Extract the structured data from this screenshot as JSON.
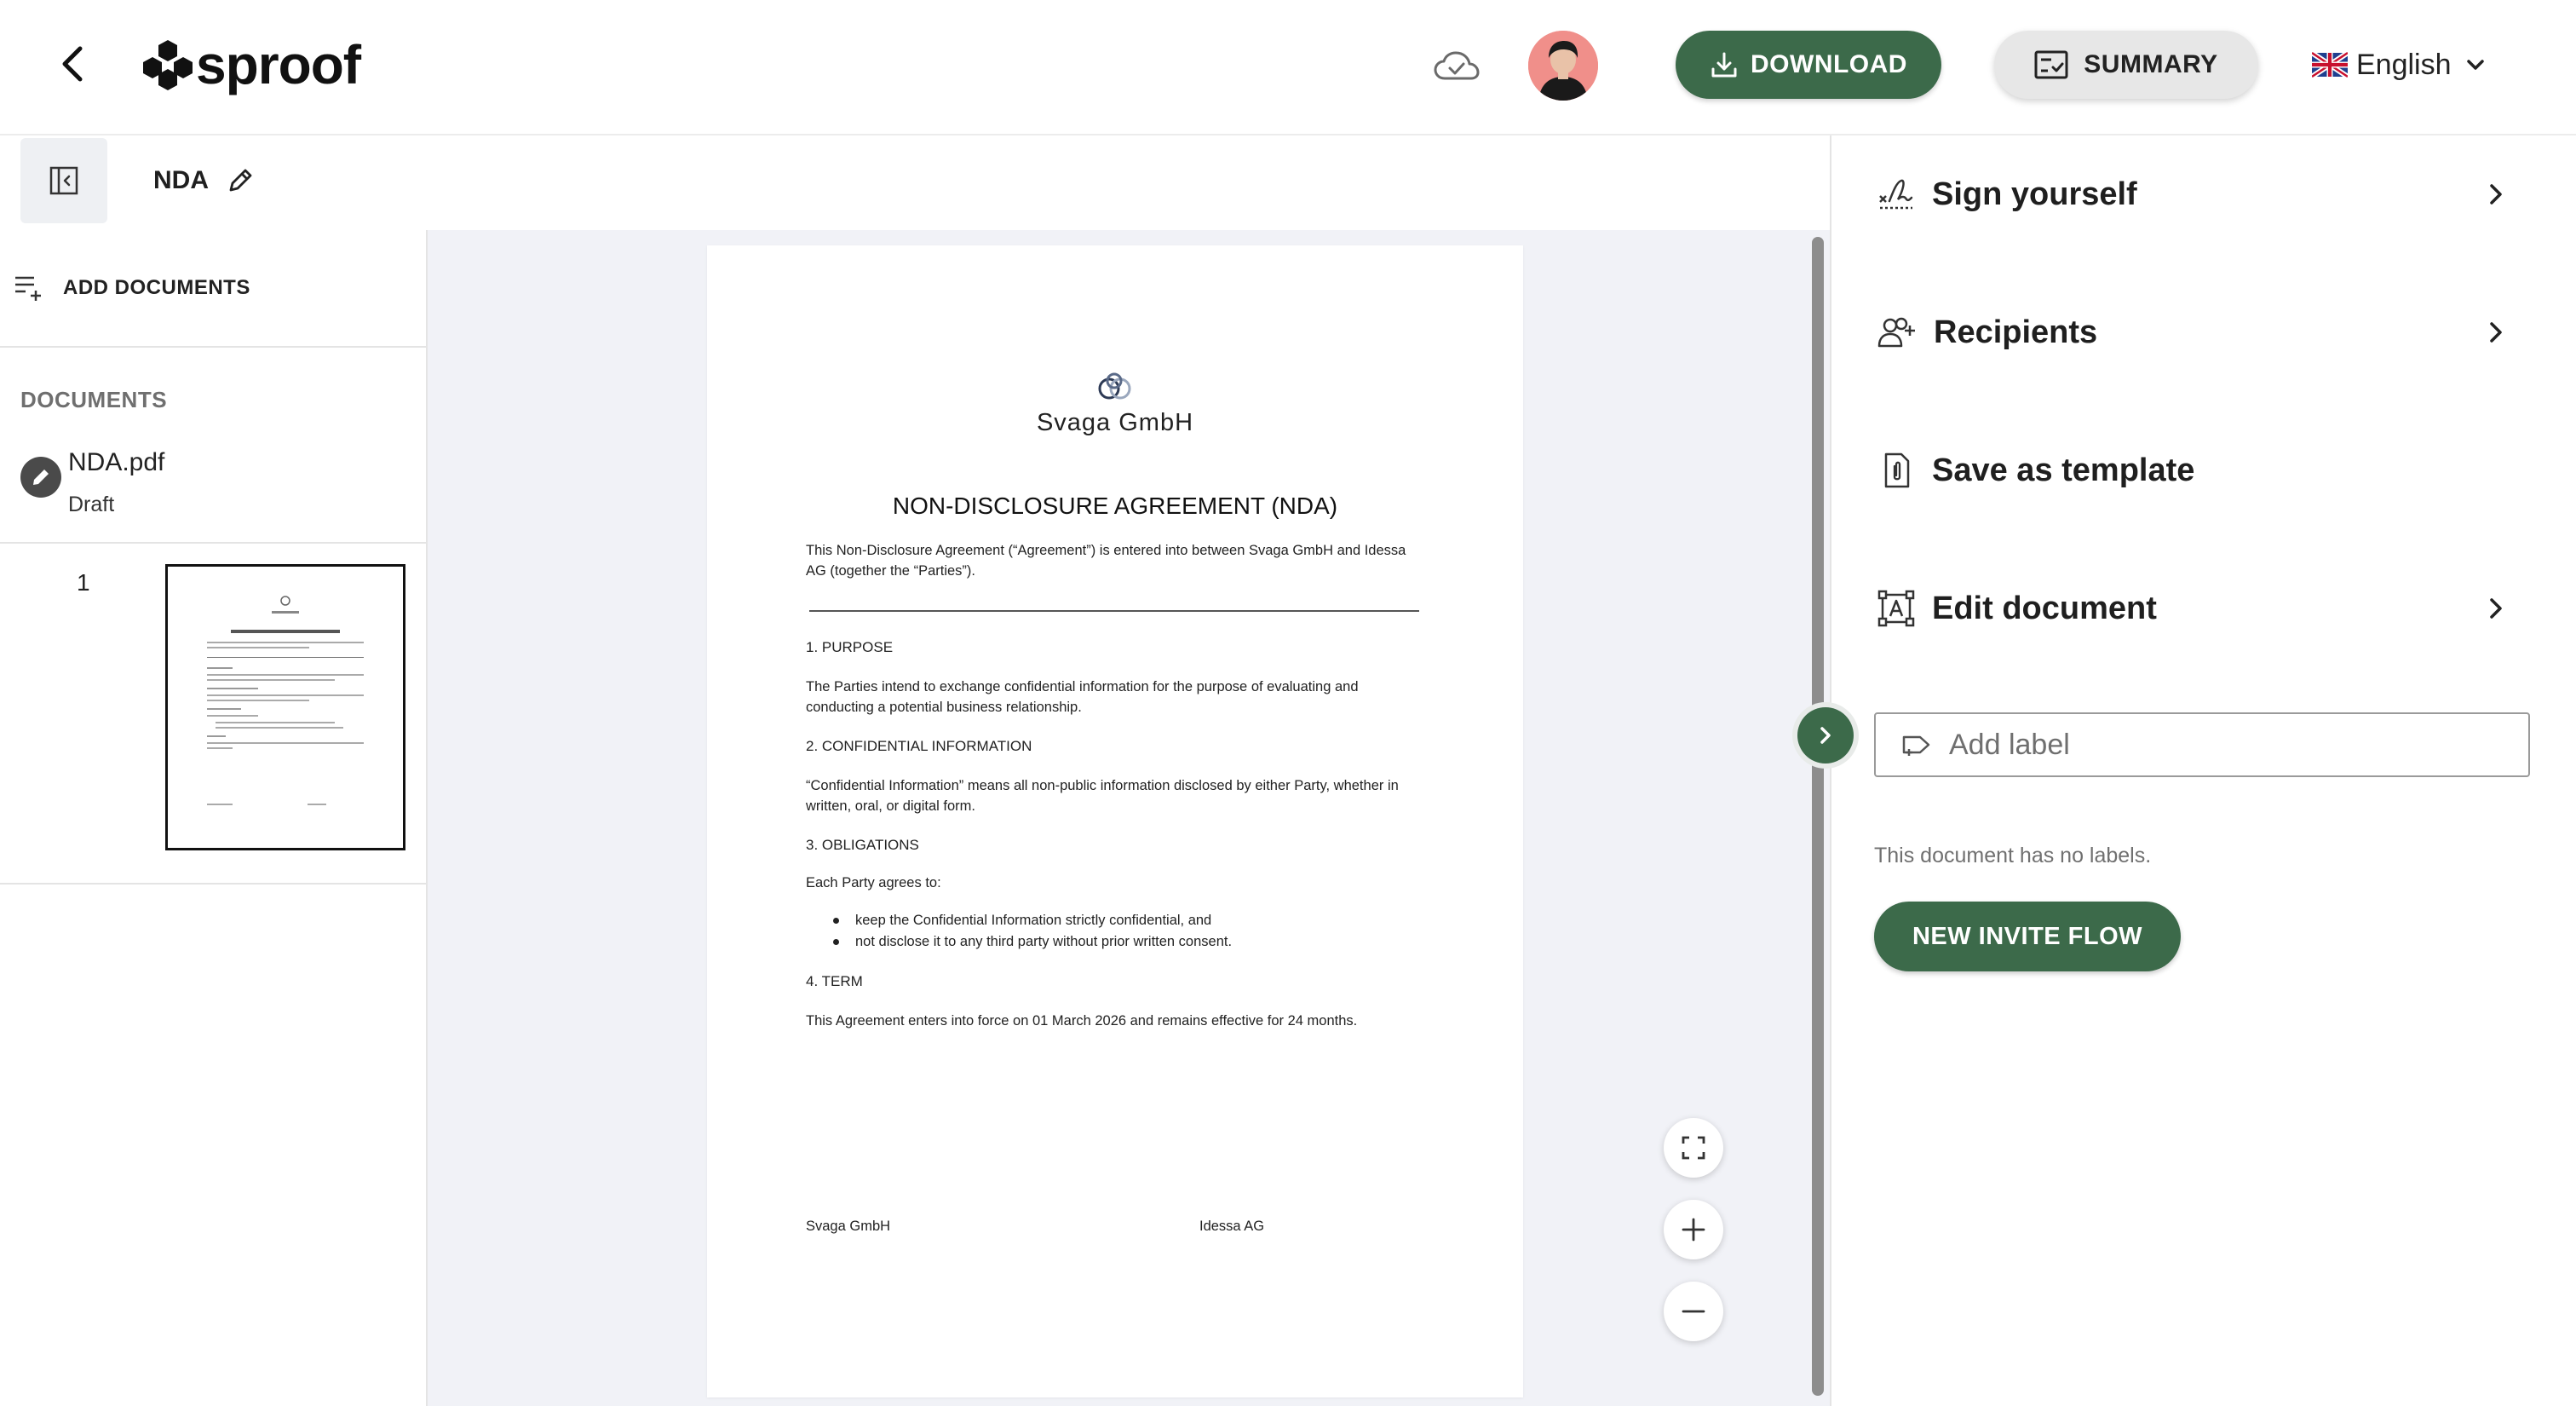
{
  "header": {
    "logo_text": "sproof",
    "download_label": "DOWNLOAD",
    "summary_label": "SUMMARY",
    "language": "English"
  },
  "toolbar": {
    "doc_title": "NDA"
  },
  "sidebar": {
    "add_documents_label": "ADD DOCUMENTS",
    "documents_heading": "DOCUMENTS",
    "document": {
      "name": "NDA.pdf",
      "status": "Draft"
    },
    "page_number": "1"
  },
  "document": {
    "company": "Svaga GmbH",
    "title": "NON-DISCLOSURE AGREEMENT (NDA)",
    "intro": "This Non-Disclosure Agreement (“Agreement”) is entered into between Svaga GmbH and Idessa AG (together the “Parties”).",
    "sections": [
      {
        "heading": "1. PURPOSE",
        "body": "The Parties intend to exchange confidential information for the purpose of evaluating and conducting a potential business relationship."
      },
      {
        "heading": "2. CONFIDENTIAL INFORMATION",
        "body": "“Confidential Information” means all non-public information disclosed by either Party, whether in written, oral, or digital form."
      },
      {
        "heading": "3. OBLIGATIONS",
        "body": "Each Party agrees to:"
      },
      {
        "heading": "4. TERM",
        "body": "This Agreement enters into force on 01 March 2026 and remains effective for 24 months."
      }
    ],
    "obligations": [
      "keep the Confidential Information strictly confidential, and",
      "not disclose it to any third party without prior written consent."
    ],
    "signatures": {
      "left": "Svaga GmbH",
      "right": "Idessa AG"
    }
  },
  "right_panel": {
    "actions": [
      {
        "label": "Sign yourself",
        "icon": "signature-icon",
        "has_chevron": true
      },
      {
        "label": "Recipients",
        "icon": "add-person-icon",
        "has_chevron": true
      },
      {
        "label": "Save as template",
        "icon": "template-file-icon",
        "has_chevron": false
      },
      {
        "label": "Edit document",
        "icon": "edit-document-icon",
        "has_chevron": true
      }
    ],
    "label_placeholder": "Add label",
    "no_labels_text": "This document has no labels.",
    "new_invite_flow_label": "NEW INVITE FLOW"
  },
  "colors": {
    "primary_green": "#3c6a4a",
    "viewer_bg": "#f1f2f7",
    "avatar_bg": "#f08f8a"
  }
}
